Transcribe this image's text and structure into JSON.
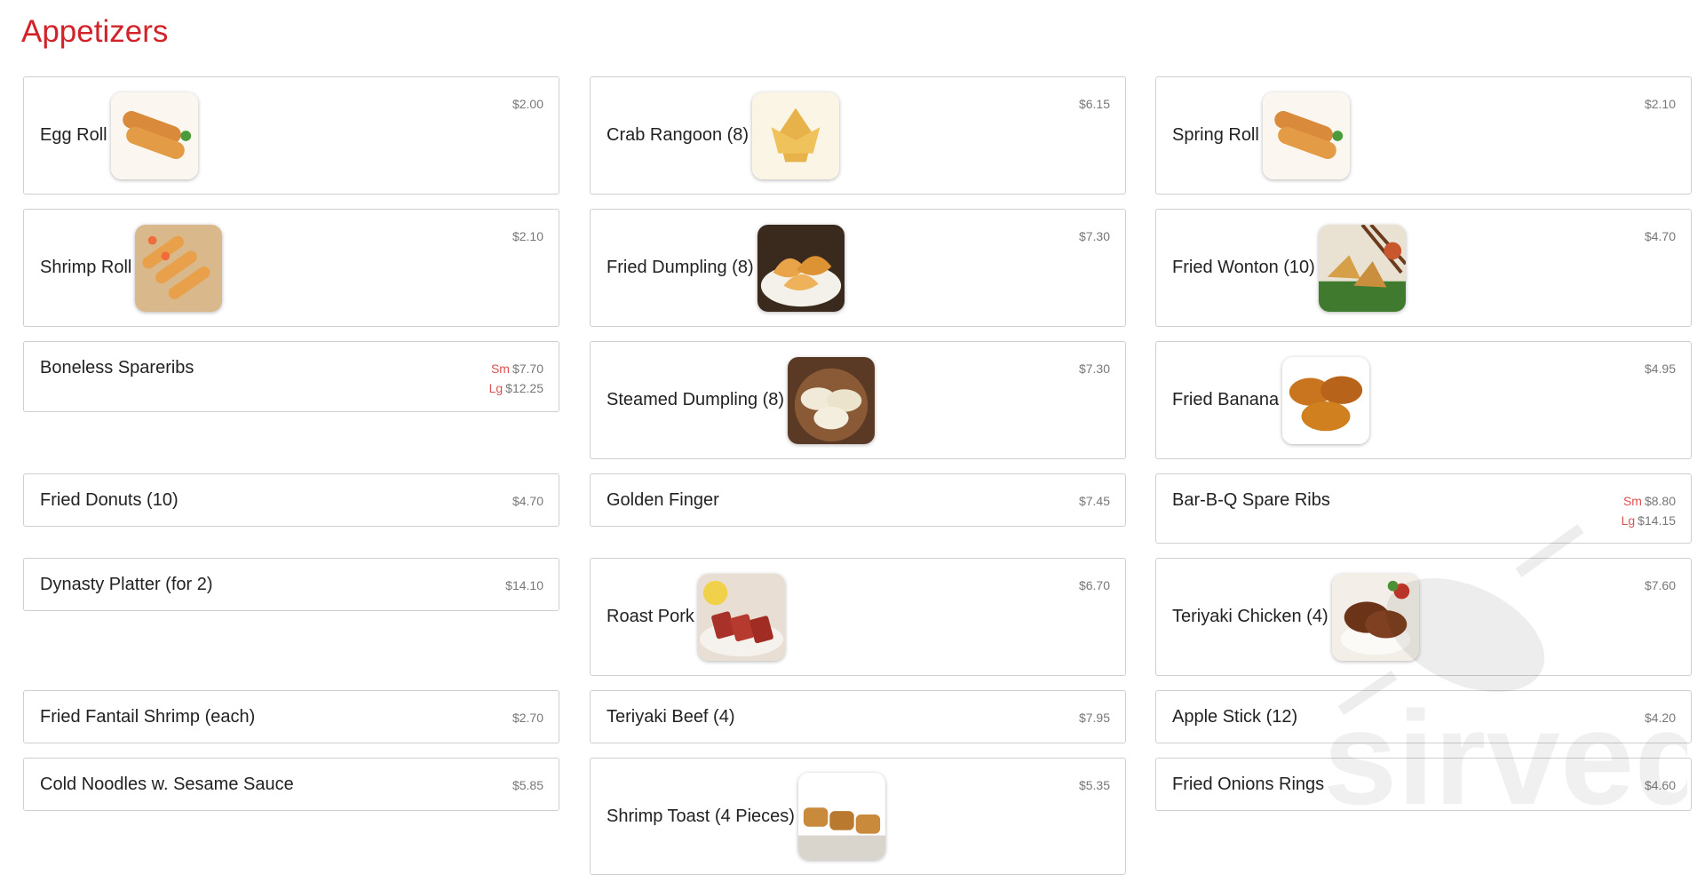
{
  "section": {
    "title": "Appetizers"
  },
  "watermark": {
    "text": "sirved"
  },
  "items": [
    {
      "name": "Egg Roll",
      "price": "$2.00",
      "image": "egg-roll-image"
    },
    {
      "name": "Crab Rangoon (8)",
      "price": "$6.15",
      "image": "crab-rangoon-image"
    },
    {
      "name": "Spring Roll",
      "price": "$2.10",
      "image": "spring-roll-image"
    },
    {
      "name": "Shrimp Roll",
      "price": "$2.10",
      "image": "shrimp-roll-image"
    },
    {
      "name": "Fried Dumpling (8)",
      "price": "$7.30",
      "image": "fried-dumpling-image"
    },
    {
      "name": "Fried Wonton (10)",
      "price": "$4.70",
      "image": "fried-wonton-image"
    },
    {
      "name": "Boneless Spareribs",
      "sizes": [
        {
          "label": "Sm",
          "price": "$7.70"
        },
        {
          "label": "Lg",
          "price": "$12.25"
        }
      ]
    },
    {
      "name": "Steamed Dumpling (8)",
      "price": "$7.30",
      "image": "steamed-dumpling-image"
    },
    {
      "name": "Fried Banana",
      "price": "$4.95",
      "image": "fried-banana-image"
    },
    {
      "name": "Fried Donuts (10)",
      "price": "$4.70"
    },
    {
      "name": "Golden Finger",
      "price": "$7.45"
    },
    {
      "name": "Bar-B-Q Spare Ribs",
      "sizes": [
        {
          "label": "Sm",
          "price": "$8.80"
        },
        {
          "label": "Lg",
          "price": "$14.15"
        }
      ]
    },
    {
      "name": "Dynasty Platter (for 2)",
      "price": "$14.10"
    },
    {
      "name": "Roast Pork",
      "price": "$6.70",
      "image": "roast-pork-image"
    },
    {
      "name": "Teriyaki Chicken (4)",
      "price": "$7.60",
      "image": "teriyaki-chicken-image"
    },
    {
      "name": "Fried Fantail Shrimp (each)",
      "price": "$2.70"
    },
    {
      "name": "Teriyaki Beef (4)",
      "price": "$7.95"
    },
    {
      "name": "Apple Stick (12)",
      "price": "$4.20"
    },
    {
      "name": "Cold Noodles w. Sesame Sauce",
      "price": "$5.85"
    },
    {
      "name": "Shrimp Toast (4 Pieces)",
      "price": "$5.35",
      "image": "shrimp-toast-image"
    },
    {
      "name": "Fried Onions Rings",
      "price": "$4.60"
    }
  ]
}
